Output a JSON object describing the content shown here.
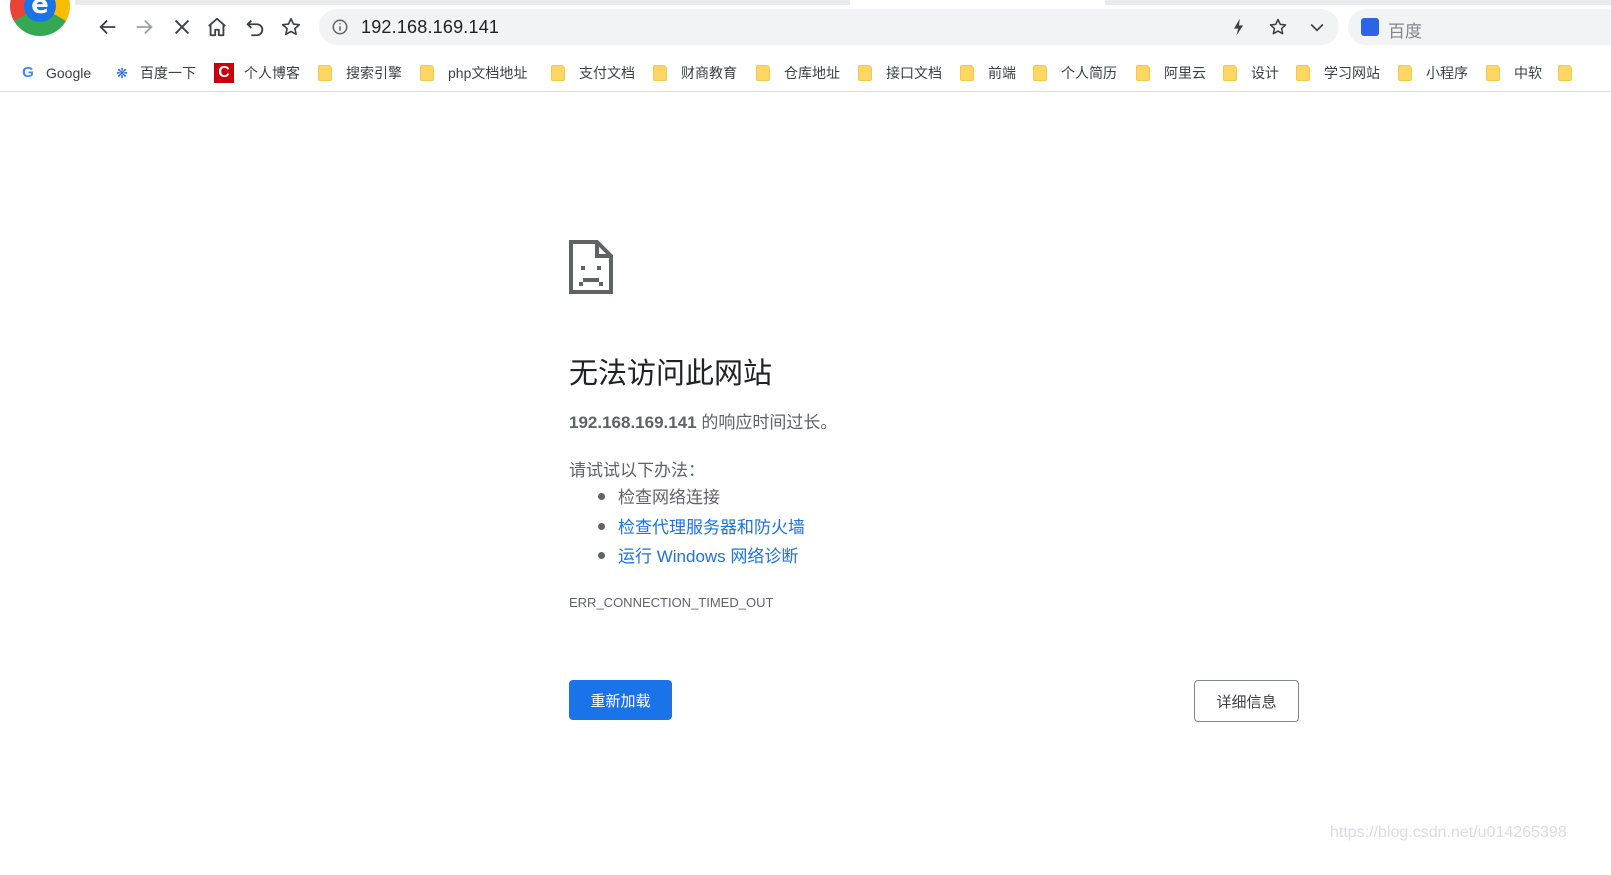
{
  "toolbar": {
    "url": "192.168.169.141",
    "search_engine_label": "百度"
  },
  "icons": {
    "back": "back-arrow-icon",
    "forward": "forward-arrow-icon",
    "stop": "stop-icon",
    "home": "home-icon",
    "undo": "undo-close-tab-icon",
    "favorite": "star-icon",
    "info": "info-icon",
    "lightning": "lightning-icon",
    "chevron": "chevron-down-icon"
  },
  "bookmarks": [
    {
      "label": "Google",
      "kind": "google"
    },
    {
      "label": "百度一下",
      "kind": "baidu"
    },
    {
      "label": "个人博客",
      "kind": "csdn"
    },
    {
      "label": "搜索引擎",
      "kind": "folder"
    },
    {
      "label": "php文档地址",
      "kind": "folder"
    },
    {
      "label": "支付文档",
      "kind": "folder"
    },
    {
      "label": "财商教育",
      "kind": "folder"
    },
    {
      "label": "仓库地址",
      "kind": "folder"
    },
    {
      "label": "接口文档",
      "kind": "folder"
    },
    {
      "label": "前端",
      "kind": "folder"
    },
    {
      "label": "个人简历",
      "kind": "folder"
    },
    {
      "label": "阿里云",
      "kind": "folder"
    },
    {
      "label": "设计",
      "kind": "folder"
    },
    {
      "label": "学习网站",
      "kind": "folder"
    },
    {
      "label": "小程序",
      "kind": "folder"
    },
    {
      "label": "中软",
      "kind": "folder"
    }
  ],
  "error": {
    "title": "无法访问此网站",
    "host": "192.168.169.141",
    "desc_suffix": " 的响应时间过长。",
    "suggest_label": "请试试以下办法：",
    "suggestions": [
      {
        "text": "检查网络连接",
        "is_link": false
      },
      {
        "text": "检查代理服务器和防火墙",
        "is_link": true
      },
      {
        "text": "运行 Windows 网络诊断",
        "is_link": true
      }
    ],
    "code": "ERR_CONNECTION_TIMED_OUT",
    "reload_label": "重新加载",
    "details_label": "详细信息"
  },
  "watermark": "https://blog.csdn.net/u014265398",
  "colors": {
    "accent": "#1a73e8",
    "text_secondary": "#5f6368",
    "folder": "#fdd663"
  }
}
